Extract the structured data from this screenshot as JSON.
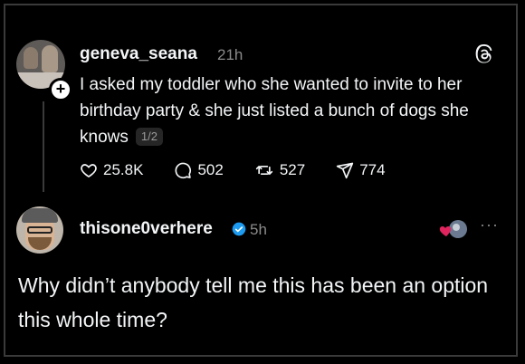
{
  "post": {
    "username": "geneva_seana",
    "time": "21h",
    "body": "I asked my toddler who she wanted to invite to her birthday party & she just listed a bunch of dogs she knows",
    "pager": "1/2",
    "likes": "25.8K",
    "comments": "502",
    "reposts": "527",
    "shares": "774"
  },
  "reply": {
    "username": "thisone0verhere",
    "time": "5h",
    "more": "···",
    "body": "Why didn’t anybody tell me this has been an option this whole time?"
  },
  "colors": {
    "background": "#000000",
    "text": "#f3f5f7",
    "muted": "#8a8a8a",
    "verified": "#1d9bf0",
    "heart": "#e0245e"
  }
}
